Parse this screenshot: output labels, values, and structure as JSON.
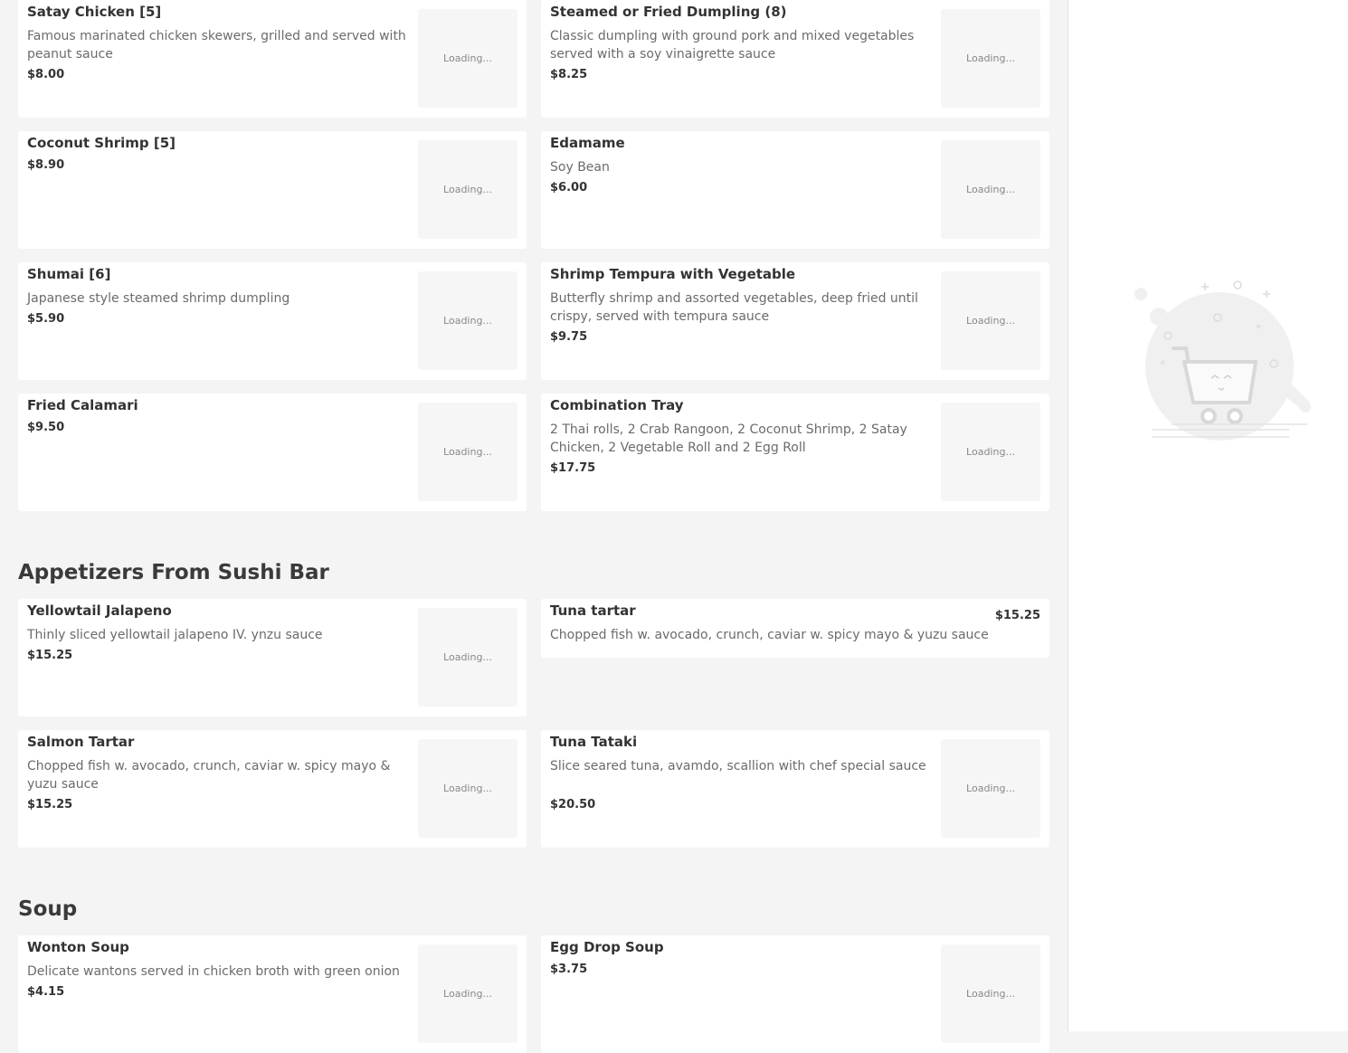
{
  "loading_text": "Loading...",
  "sections": [
    {
      "title": "",
      "items": [
        {
          "name": "Satay Chicken [5]",
          "description": "Famous marinated chicken skewers, grilled and served with peanut sauce",
          "price": "$8.00",
          "has_image": true
        },
        {
          "name": "Steamed or Fried Dumpling (8)",
          "description": "Classic dumpling with ground pork and mixed vegetables served with a soy vinaigrette sauce",
          "price": "$8.25",
          "has_image": true
        },
        {
          "name": "Coconut Shrimp [5]",
          "description": "",
          "price": "$8.90",
          "has_image": true
        },
        {
          "name": "Edamame",
          "description": "Soy Bean",
          "price": "$6.00",
          "has_image": true
        },
        {
          "name": "Shumai [6]",
          "description": "Japanese style steamed shrimp dumpling",
          "price": "$5.90",
          "has_image": true
        },
        {
          "name": "Shrimp Tempura with Vegetable",
          "description": "Butterfly shrimp and assorted vegetables, deep fried until crispy, served with tempura sauce",
          "price": "$9.75",
          "has_image": true
        },
        {
          "name": "Fried Calamari",
          "description": "",
          "price": "$9.50",
          "has_image": true
        },
        {
          "name": "Combination Tray",
          "description": "2 Thai rolls, 2 Crab Rangoon, 2 Coconut Shrimp, 2 Satay Chicken, 2 Vegetable Roll and 2 Egg Roll",
          "price": "$17.75",
          "has_image": true
        }
      ]
    },
    {
      "title": "Appetizers From Sushi Bar",
      "items": [
        {
          "name": "Yellowtail Jalapeno",
          "description": "Thinly sliced yellowtail jalapeno IV. ynzu sauce",
          "price": "$15.25",
          "has_image": true
        },
        {
          "name": "Tuna tartar",
          "description": "Chopped fish w. avocado, crunch, caviar w. spicy mayo & yuzu sauce",
          "price": "$15.25",
          "has_image": false
        },
        {
          "name": "Salmon Tartar",
          "description": "Chopped fish w. avocado, crunch, caviar w. spicy mayo & yuzu sauce",
          "price": "$15.25",
          "has_image": true
        },
        {
          "name": "Tuna Tataki",
          "description": "Slice seared tuna, avamdo, scallion with chef special sauce",
          "price": "$20.50",
          "has_image": true
        }
      ]
    },
    {
      "title": "Soup",
      "items": [
        {
          "name": "Wonton Soup",
          "description": "Delicate wantons served in chicken broth with green onion",
          "price": "$4.15",
          "has_image": true
        },
        {
          "name": "Egg Drop Soup",
          "description": "",
          "price": "$3.75",
          "has_image": true
        }
      ]
    }
  ],
  "cart": {
    "art_icon": "empty-cart-illustration-icon"
  }
}
